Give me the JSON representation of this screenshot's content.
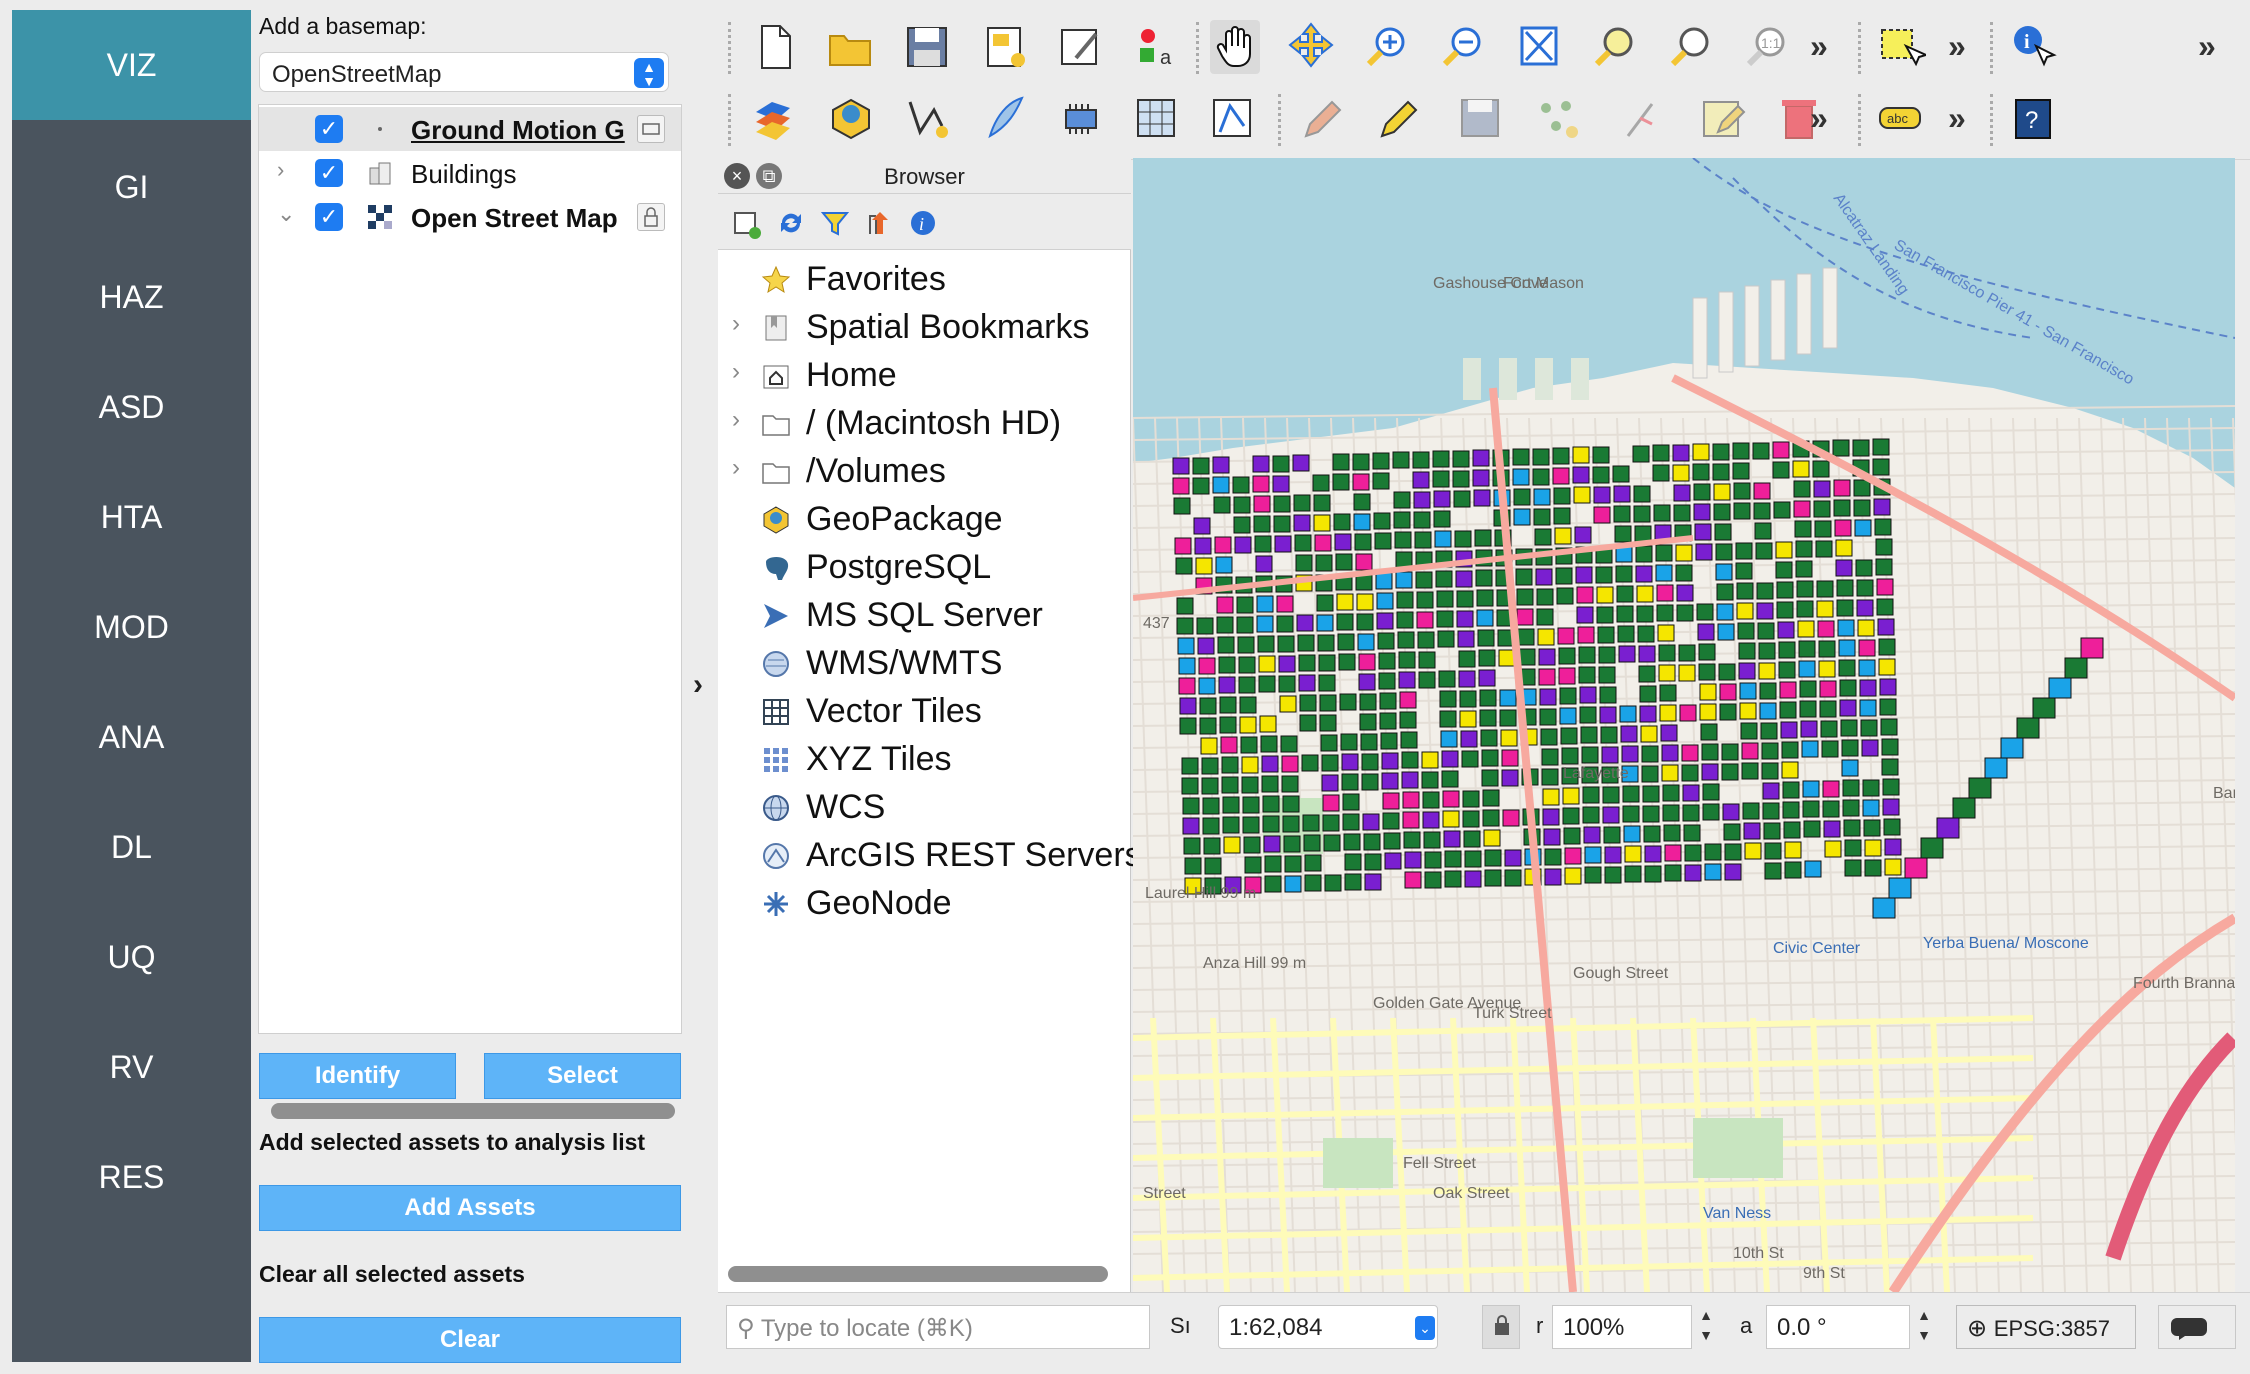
{
  "nav": {
    "items": [
      {
        "label": "VIZ",
        "active": true
      },
      {
        "label": "GI"
      },
      {
        "label": "HAZ"
      },
      {
        "label": "ASD"
      },
      {
        "label": "HTA"
      },
      {
        "label": "MOD"
      },
      {
        "label": "ANA"
      },
      {
        "label": "DL"
      },
      {
        "label": "UQ"
      },
      {
        "label": "RV"
      },
      {
        "label": "RES"
      }
    ]
  },
  "left": {
    "basemap_label": "Add a basemap:",
    "basemap_value": "OpenStreetMap",
    "layers": [
      {
        "name": "Ground Motion G",
        "checked": true,
        "expander": ""
      },
      {
        "name": "Buildings",
        "checked": true,
        "expander": "›"
      },
      {
        "name": "Open Street Map",
        "checked": true,
        "expander": "⌄"
      }
    ],
    "identify_label": "Identify",
    "select_label": "Select",
    "add_assets_heading": "Add selected assets to analysis list",
    "add_assets_label": "Add Assets",
    "clear_heading": "Clear all selected assets",
    "clear_label": "Clear"
  },
  "browser": {
    "title": "Browser",
    "items": [
      {
        "label": "Favorites",
        "icon": "star-icon",
        "expander": ""
      },
      {
        "label": "Spatial Bookmarks",
        "icon": "bookmark-icon",
        "expander": "›"
      },
      {
        "label": "Home",
        "icon": "home-icon",
        "expander": "›"
      },
      {
        "label": "/ (Macintosh HD)",
        "icon": "folder-icon",
        "expander": "›"
      },
      {
        "label": "/Volumes",
        "icon": "folder-icon",
        "expander": "›"
      },
      {
        "label": "GeoPackage",
        "icon": "geopackage-icon",
        "expander": ""
      },
      {
        "label": "PostgreSQL",
        "icon": "postgresql-icon",
        "expander": ""
      },
      {
        "label": "MS SQL Server",
        "icon": "mssql-icon",
        "expander": ""
      },
      {
        "label": "WMS/WMTS",
        "icon": "wms-icon",
        "expander": ""
      },
      {
        "label": "Vector Tiles",
        "icon": "vector-tiles-icon",
        "expander": ""
      },
      {
        "label": "XYZ Tiles",
        "icon": "xyz-tiles-icon",
        "expander": ""
      },
      {
        "label": "WCS",
        "icon": "wcs-icon",
        "expander": ""
      },
      {
        "label": "ArcGIS REST Servers",
        "icon": "arcgis-icon",
        "expander": ""
      },
      {
        "label": "GeoNode",
        "icon": "geonode-icon",
        "expander": ""
      }
    ]
  },
  "map": {
    "labels": [
      {
        "text": "Gashouse Cove"
      },
      {
        "text": "Fort Mason"
      },
      {
        "text": "San Francisco Pier 41 - San Francisco"
      },
      {
        "text": "Alcatraz Landing"
      },
      {
        "text": "Lafayette"
      },
      {
        "text": "Laurel Hill 99 m"
      },
      {
        "text": "Anza Hill 99 m"
      },
      {
        "text": "Golden Gate Avenue"
      },
      {
        "text": "Turk Street"
      },
      {
        "text": "Fell Street"
      },
      {
        "text": "Oak Street"
      },
      {
        "text": "Civic Center"
      },
      {
        "text": "Van Ness"
      },
      {
        "text": "Yerba Buena/ Moscone"
      },
      {
        "text": "Fourth Branna"
      },
      {
        "text": "Gough Street"
      },
      {
        "text": "10th St"
      },
      {
        "text": "9th St"
      },
      {
        "text": "Street"
      },
      {
        "text": "Barca"
      },
      {
        "text": "437"
      }
    ],
    "colors": {
      "water": "#aad3df",
      "land": "#f2efe9",
      "green": "#1a7a34",
      "purple": "#7a1fd0",
      "pink": "#ee1f9a",
      "yellow": "#f5e600",
      "cyan": "#1aa3e8",
      "road": "#f7a99f",
      "minor": "#fefbb9"
    }
  },
  "status": {
    "locate_placeholder": "Type to locate (⌘K)",
    "scale_label": "Sı",
    "scale_value": "1:62,084",
    "magnifier_label": "r",
    "magnifier_value": "100%",
    "rotation_label": "a",
    "rotation_value": "0.0 °",
    "crs": "EPSG:3857"
  }
}
